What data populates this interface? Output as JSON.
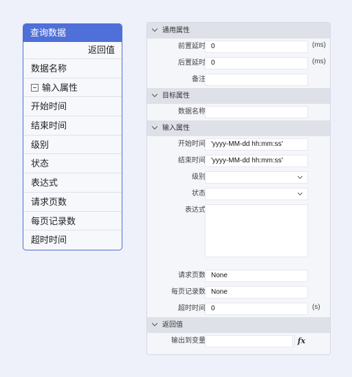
{
  "node": {
    "title": "查询数据",
    "return_label": "返回值",
    "data_name": "数据名称",
    "input_group": "输入属性",
    "fields": [
      "开始时间",
      "结束时间",
      "级别",
      "状态",
      "表达式",
      "请求页数",
      "每页记录数",
      "超时时间"
    ]
  },
  "panel": {
    "general": {
      "title": "通用属性",
      "pre_delay_label": "前置延时",
      "pre_delay_value": "0",
      "pre_delay_unit": "(ms)",
      "post_delay_label": "后置延时",
      "post_delay_value": "0",
      "post_delay_unit": "(ms)",
      "remark_label": "备注",
      "remark_value": ""
    },
    "target": {
      "title": "目标属性",
      "data_name_label": "数据名称",
      "data_name_value": ""
    },
    "input": {
      "title": "输入属性",
      "start_time_label": "开始时间",
      "start_time_value": "'yyyy-MM-dd hh:mm:ss'",
      "end_time_label": "结束时间",
      "end_time_value": "'yyyy-MM-dd hh:mm:ss'",
      "level_label": "级别",
      "level_value": "",
      "status_label": "状态",
      "status_value": "",
      "expression_label": "表达式",
      "page_label": "请求页数",
      "page_value": "None",
      "per_page_label": "每页记录数",
      "per_page_value": "None",
      "timeout_label": "超时时间",
      "timeout_value": "0",
      "timeout_unit": "(s)"
    },
    "output": {
      "title": "返回值",
      "output_var_label": "输出到变量",
      "output_var_value": "",
      "fx_label": "fx"
    }
  }
}
